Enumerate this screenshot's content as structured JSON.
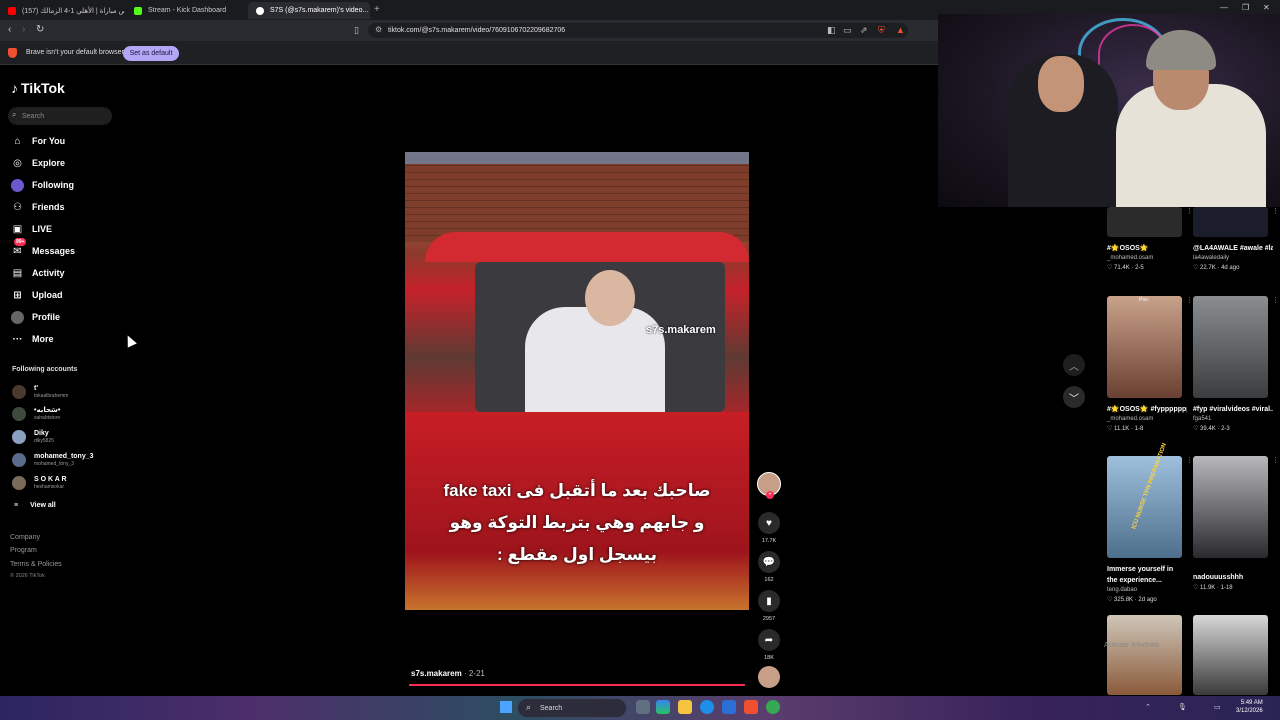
{
  "browser": {
    "tabs": [
      {
        "title": "(157) ملخص مباراة | الأهلي 1-4 الزمالك..."
      },
      {
        "title": "Stream - Kick Dashboard"
      },
      {
        "title": "S7S (@s7s.makarem)'s video..."
      }
    ],
    "url": "tiktok.com/@s7s.makarem/video/7609106702209682706",
    "infobar_message": "Brave isn't your default browser",
    "set_default_label": "Set as default"
  },
  "sidebar": {
    "logo": "TikTok",
    "search_placeholder": "Search",
    "nav": [
      {
        "label": "For You",
        "icon": "home-icon"
      },
      {
        "label": "Explore",
        "icon": "compass-icon"
      },
      {
        "label": "Following",
        "icon": "following-icon"
      },
      {
        "label": "Friends",
        "icon": "friends-icon"
      },
      {
        "label": "LIVE",
        "icon": "live-icon"
      },
      {
        "label": "Messages",
        "icon": "messages-icon",
        "badge": "99+"
      },
      {
        "label": "Activity",
        "icon": "activity-icon"
      },
      {
        "label": "Upload",
        "icon": "upload-icon"
      },
      {
        "label": "Profile",
        "icon": "profile-icon"
      },
      {
        "label": "More",
        "icon": "more-icon"
      }
    ],
    "following_title": "Following accounts",
    "accounts": [
      {
        "name": "t'",
        "handle": "tokaalbrahemm"
      },
      {
        "name": "•سَحابه•",
        "handle": "sahabtstore"
      },
      {
        "name": "Diky",
        "handle": "diky5825"
      },
      {
        "name": "mohamed_tony_3",
        "handle": "mohamed_tony_3"
      },
      {
        "name": "S O K A R",
        "handle": "heshamsokar"
      }
    ],
    "view_all": "View all",
    "footer": {
      "company": "Company",
      "program": "Program",
      "terms": "Terms & Policies",
      "copyright": "© 2026 TikTok"
    }
  },
  "video": {
    "watermark": "s7s.makarem",
    "caption_line1": "صاحبك بعد ما أتقبل فى fake taxi",
    "caption_line2": "و جابهم وهي بتربط التوكة وهو",
    "caption_line3": "بيسجل اول مقطع :",
    "author": "s7s.makarem",
    "date": "2-21",
    "progress": 1.0,
    "likes": "17.7K",
    "comments": "162",
    "saves": "2957",
    "shares": "18K"
  },
  "recommendations": [
    {
      "title": "#🌟OSOS🌟",
      "user": "_mohamed.osam",
      "likes": "71.4K",
      "date": "2-5",
      "color": "#2b2b2b"
    },
    {
      "title": "@LA4AWALE #awale #la4awal...",
      "user": "la4awaledaily",
      "likes": "22.7K",
      "date": "4d ago",
      "color": "#1b1d2a"
    },
    {
      "title": "#🌟OSOS🌟 #fypppppppppp...",
      "user": "_mohamed.osam",
      "likes": "11.1K",
      "date": "1-8",
      "color": "#a0675a"
    },
    {
      "title": "#fyp #viralvideos #viral...",
      "user": "fga541",
      "likes": "39.4K",
      "date": "2-3",
      "color": "#5a5e60"
    },
    {
      "title": "Immerse yourself in the experience...",
      "user": "teng.dabao",
      "likes": "325.8K",
      "date": "2d ago",
      "color": "#7aa3c5"
    },
    {
      "title": "nadouuusshhh",
      "user": "",
      "likes": "11.9K",
      "date": "1-18",
      "color": "#3a3a3e"
    }
  ],
  "rec_thumb_texts": {
    "pov": "Pov:",
    "icu": "ICU NURSE TPN PREPARATION"
  },
  "activate": "Activate Windows",
  "taskbar": {
    "search": "Search",
    "time": "5:49 AM",
    "date": "3/12/2026"
  }
}
